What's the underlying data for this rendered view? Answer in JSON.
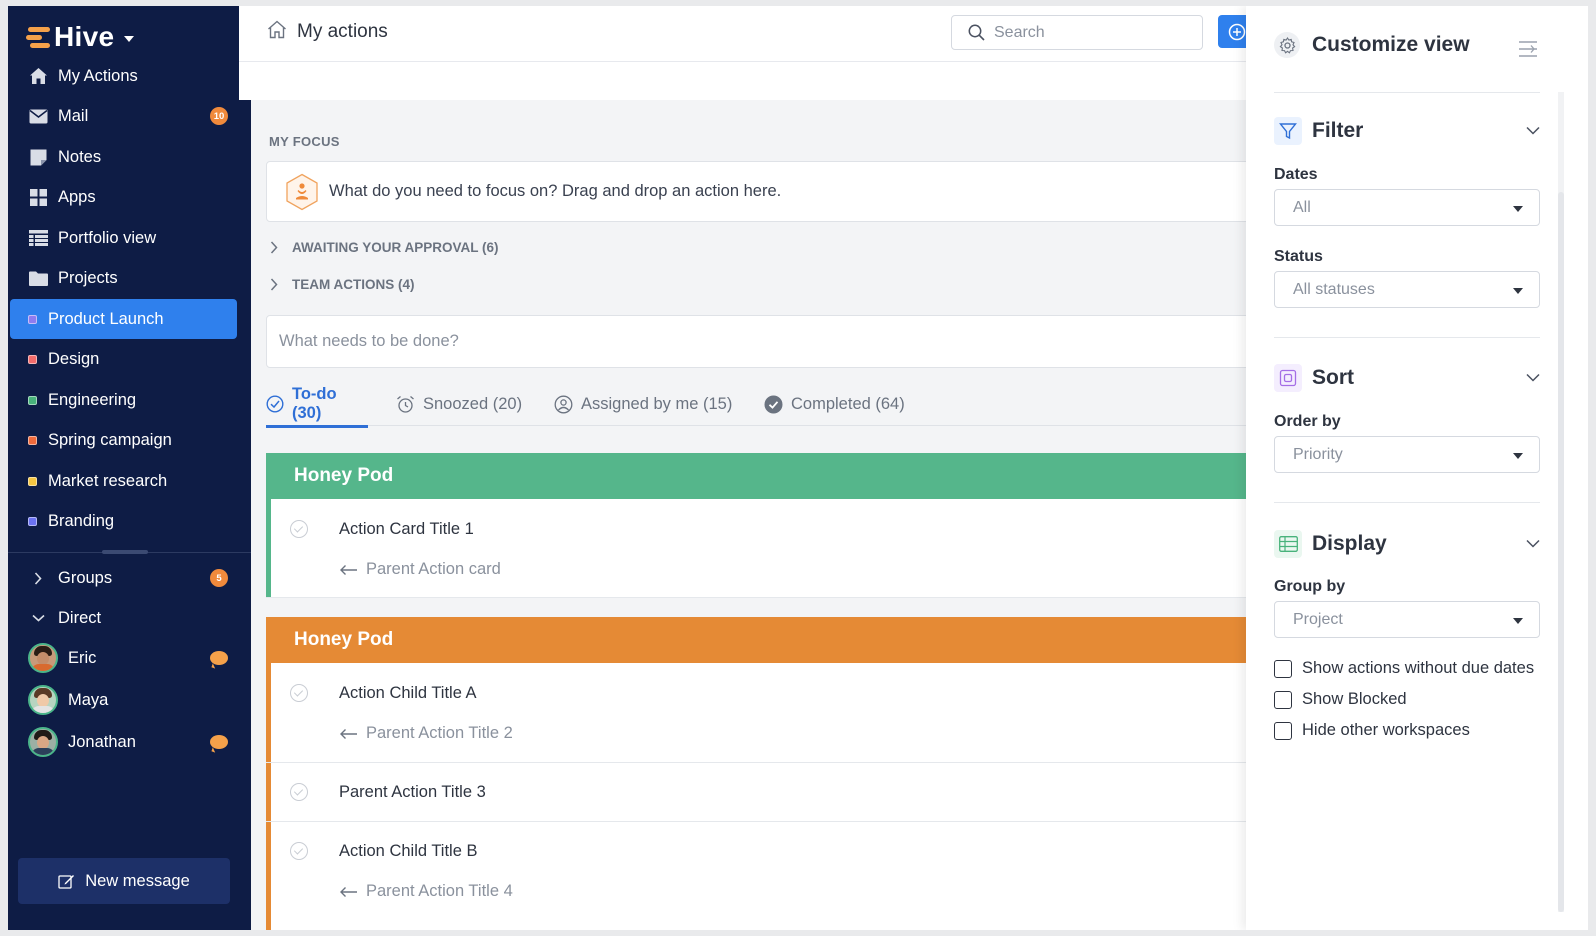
{
  "app": {
    "name": "Hive"
  },
  "sidebar": {
    "nav": [
      {
        "label": "My Actions",
        "icon": "home-icon"
      },
      {
        "label": "Mail",
        "icon": "mail-icon",
        "badge": "10"
      },
      {
        "label": "Notes",
        "icon": "notes-icon"
      },
      {
        "label": "Apps",
        "icon": "apps-icon"
      },
      {
        "label": "Portfolio view",
        "icon": "portfolio-icon"
      },
      {
        "label": "Projects",
        "icon": "folder-icon"
      }
    ],
    "projects": [
      {
        "label": "Product Launch",
        "color": "#8e7cf0",
        "active": true
      },
      {
        "label": "Design",
        "color": "#f26b6b"
      },
      {
        "label": "Engineering",
        "color": "#48b27b"
      },
      {
        "label": "Spring campaign",
        "color": "#ef6a3c"
      },
      {
        "label": "Market research",
        "color": "#f4c542"
      },
      {
        "label": "Branding",
        "color": "#6b72f2"
      }
    ],
    "groups": {
      "label": "Groups",
      "badge": "5"
    },
    "direct": {
      "label": "Direct"
    },
    "dms": [
      {
        "name": "Eric",
        "has_unread": true
      },
      {
        "name": "Maya",
        "has_unread": false
      },
      {
        "name": "Jonathan",
        "has_unread": true
      }
    ],
    "new_message_label": "New message"
  },
  "header": {
    "title": "My actions",
    "search_placeholder": "Search"
  },
  "main": {
    "focus_label": "MY FOCUS",
    "focus_prompt": "What do you need to focus on? Drag and drop an action here.",
    "awaiting_label": "AWAITING YOUR APPROVAL (6)",
    "team_label": "TEAM ACTIONS (4)",
    "todo_placeholder": "What needs to be done?",
    "tabs": [
      {
        "label": "To-do (30)",
        "icon": "check-circle-icon",
        "active": true
      },
      {
        "label": "Snoozed (20)",
        "icon": "alarm-icon"
      },
      {
        "label": "Assigned by me (15)",
        "icon": "user-circle-icon"
      },
      {
        "label": "Completed (64)",
        "icon": "check-filled-icon"
      }
    ],
    "groups": [
      {
        "name": "Honey Pod",
        "color": "#55b68b",
        "cards": [
          {
            "title": "Action Card Title 1",
            "parent": "Parent Action card"
          }
        ]
      },
      {
        "name": "Honey Pod",
        "color": "#e58a35",
        "cards": [
          {
            "title": "Action Child Title A",
            "parent": "Parent Action Title 2"
          },
          {
            "title": "Parent Action Title 3",
            "parent": ""
          },
          {
            "title": "Action Child Title B",
            "parent": "Parent Action Title 4"
          }
        ]
      }
    ]
  },
  "panel": {
    "title": "Customize view",
    "filter": {
      "title": "Filter",
      "dates_label": "Dates",
      "dates_value": "All",
      "status_label": "Status",
      "status_value": "All statuses"
    },
    "sort": {
      "title": "Sort",
      "order_label": "Order by",
      "order_value": "Priority"
    },
    "display": {
      "title": "Display",
      "group_label": "Group by",
      "group_value": "Project",
      "options": [
        {
          "label": "Show actions without due dates",
          "checked": false
        },
        {
          "label": "Show Blocked",
          "checked": false
        },
        {
          "label": "Hide other workspaces",
          "checked": false
        }
      ]
    }
  }
}
